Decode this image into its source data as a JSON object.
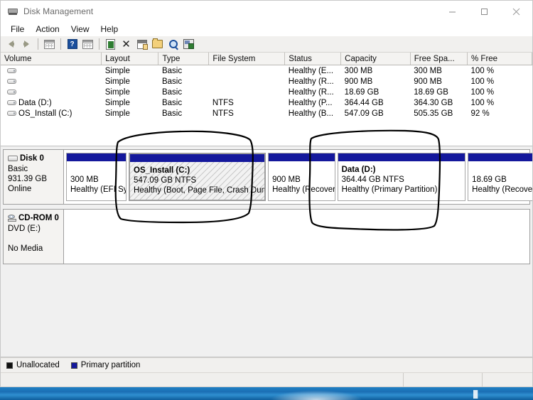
{
  "window": {
    "title": "Disk Management",
    "title_icon": "disk-management-icon",
    "controls": {
      "minimize": "minimize-icon",
      "maximize": "maximize-icon",
      "close": "close-icon"
    }
  },
  "menubar": {
    "items": [
      {
        "label": "File"
      },
      {
        "label": "Action"
      },
      {
        "label": "View"
      },
      {
        "label": "Help"
      }
    ]
  },
  "toolbar": {
    "buttons": [
      {
        "name": "back-icon",
        "type": "arrow-left",
        "tooltip": "Back"
      },
      {
        "name": "forward-icon",
        "type": "arrow-right",
        "tooltip": "Forward"
      },
      {
        "name": "show-hide-console-tree-icon",
        "type": "tree",
        "tooltip": "Show/Hide Console Tree"
      },
      {
        "name": "help-icon",
        "type": "help",
        "tooltip": "Help"
      },
      {
        "name": "show-hide-action-pane-icon",
        "type": "tree",
        "tooltip": "Show/Hide Action Pane"
      },
      {
        "name": "rescan-disks-icon",
        "type": "page",
        "tooltip": "Rescan Disks"
      },
      {
        "name": "delete-icon",
        "type": "x",
        "tooltip": "Delete"
      },
      {
        "name": "properties-icon",
        "type": "properties",
        "tooltip": "Properties"
      },
      {
        "name": "open-icon",
        "type": "folder",
        "tooltip": "Open"
      },
      {
        "name": "explore-icon",
        "type": "magnifier",
        "tooltip": "Explore"
      },
      {
        "name": "disk-view-icon",
        "type": "disk",
        "tooltip": "Disk View"
      }
    ]
  },
  "volume_list": {
    "columns": [
      {
        "label": "Volume",
        "width": 106
      },
      {
        "label": "Layout",
        "width": 60
      },
      {
        "label": "Type",
        "width": 53
      },
      {
        "label": "File System",
        "width": 80
      },
      {
        "label": "Status",
        "width": 59
      },
      {
        "label": "Capacity",
        "width": 73
      },
      {
        "label": "Free Spa...",
        "width": 60
      },
      {
        "label": "% Free",
        "width": 68
      }
    ],
    "rows": [
      {
        "icon": "volume-icon",
        "volume": "",
        "layout": "Simple",
        "type": "Basic",
        "file_system": "",
        "status": "Healthy (E...",
        "capacity": "300 MB",
        "free_space": "300 MB",
        "percent_free": "100 %"
      },
      {
        "icon": "volume-icon",
        "volume": "",
        "layout": "Simple",
        "type": "Basic",
        "file_system": "",
        "status": "Healthy (R...",
        "capacity": "900 MB",
        "free_space": "900 MB",
        "percent_free": "100 %"
      },
      {
        "icon": "volume-icon",
        "volume": "",
        "layout": "Simple",
        "type": "Basic",
        "file_system": "",
        "status": "Healthy (R...",
        "capacity": "18.69 GB",
        "free_space": "18.69 GB",
        "percent_free": "100 %"
      },
      {
        "icon": "volume-icon",
        "volume": "Data (D:)",
        "layout": "Simple",
        "type": "Basic",
        "file_system": "NTFS",
        "status": "Healthy (P...",
        "capacity": "364.44 GB",
        "free_space": "364.30 GB",
        "percent_free": "100 %"
      },
      {
        "icon": "volume-icon",
        "volume": "OS_Install (C:)",
        "layout": "Simple",
        "type": "Basic",
        "file_system": "NTFS",
        "status": "Healthy (B...",
        "capacity": "547.09 GB",
        "free_space": "505.35 GB",
        "percent_free": "92 %"
      }
    ]
  },
  "graphical_view": {
    "disks": [
      {
        "name": "Disk 0",
        "icon": "disk-icon",
        "type": "Basic",
        "size": "931.39 GB",
        "status": "Online",
        "partitions": [
          {
            "title": "",
            "size": "300 MB",
            "status": "Healthy (EFI Sy",
            "flex": 79,
            "selected": false
          },
          {
            "title": "OS_Install  (C:)",
            "size": "547.09 GB NTFS",
            "status": "Healthy (Boot, Page File, Crash Dump, I",
            "flex": 180,
            "selected": true
          },
          {
            "title": "",
            "size": "900 MB",
            "status": "Healthy (Recovery",
            "flex": 88,
            "selected": false
          },
          {
            "title": "Data  (D:)",
            "size": "364.44 GB NTFS",
            "status": "Healthy (Primary Partition)",
            "flex": 170,
            "selected": false
          },
          {
            "title": "",
            "size": "18.69 GB",
            "status": "Healthy (Recovery Partition)",
            "flex": 134,
            "selected": false
          }
        ]
      }
    ],
    "cdrom": {
      "name": "CD-ROM 0",
      "icon": "cdrom-icon",
      "media_type": "DVD (E:)",
      "status": "No Media"
    }
  },
  "legend": {
    "items": [
      {
        "label": "Unallocated",
        "color": "#101010",
        "swatch": "unallocated-swatch"
      },
      {
        "label": "Primary partition",
        "color": "#14189c",
        "swatch": "primary-partition-swatch"
      }
    ]
  },
  "status_bar": {
    "message": "",
    "segment_1": "",
    "segment_2": ""
  },
  "annotations": {
    "shapes": [
      {
        "name": "hand-drawn-circle-os-install",
        "target": "OS_Install (C:) partition",
        "color": "#000000"
      },
      {
        "name": "hand-drawn-circle-data",
        "target": "Data (D:) partition",
        "color": "#000000"
      }
    ]
  },
  "colors": {
    "partition_bar": "#14189c",
    "unallocated": "#101010",
    "window_bg": "#ffffff",
    "pane_bg": "#f0f0f0",
    "taskbar": "#1b6fb4"
  }
}
